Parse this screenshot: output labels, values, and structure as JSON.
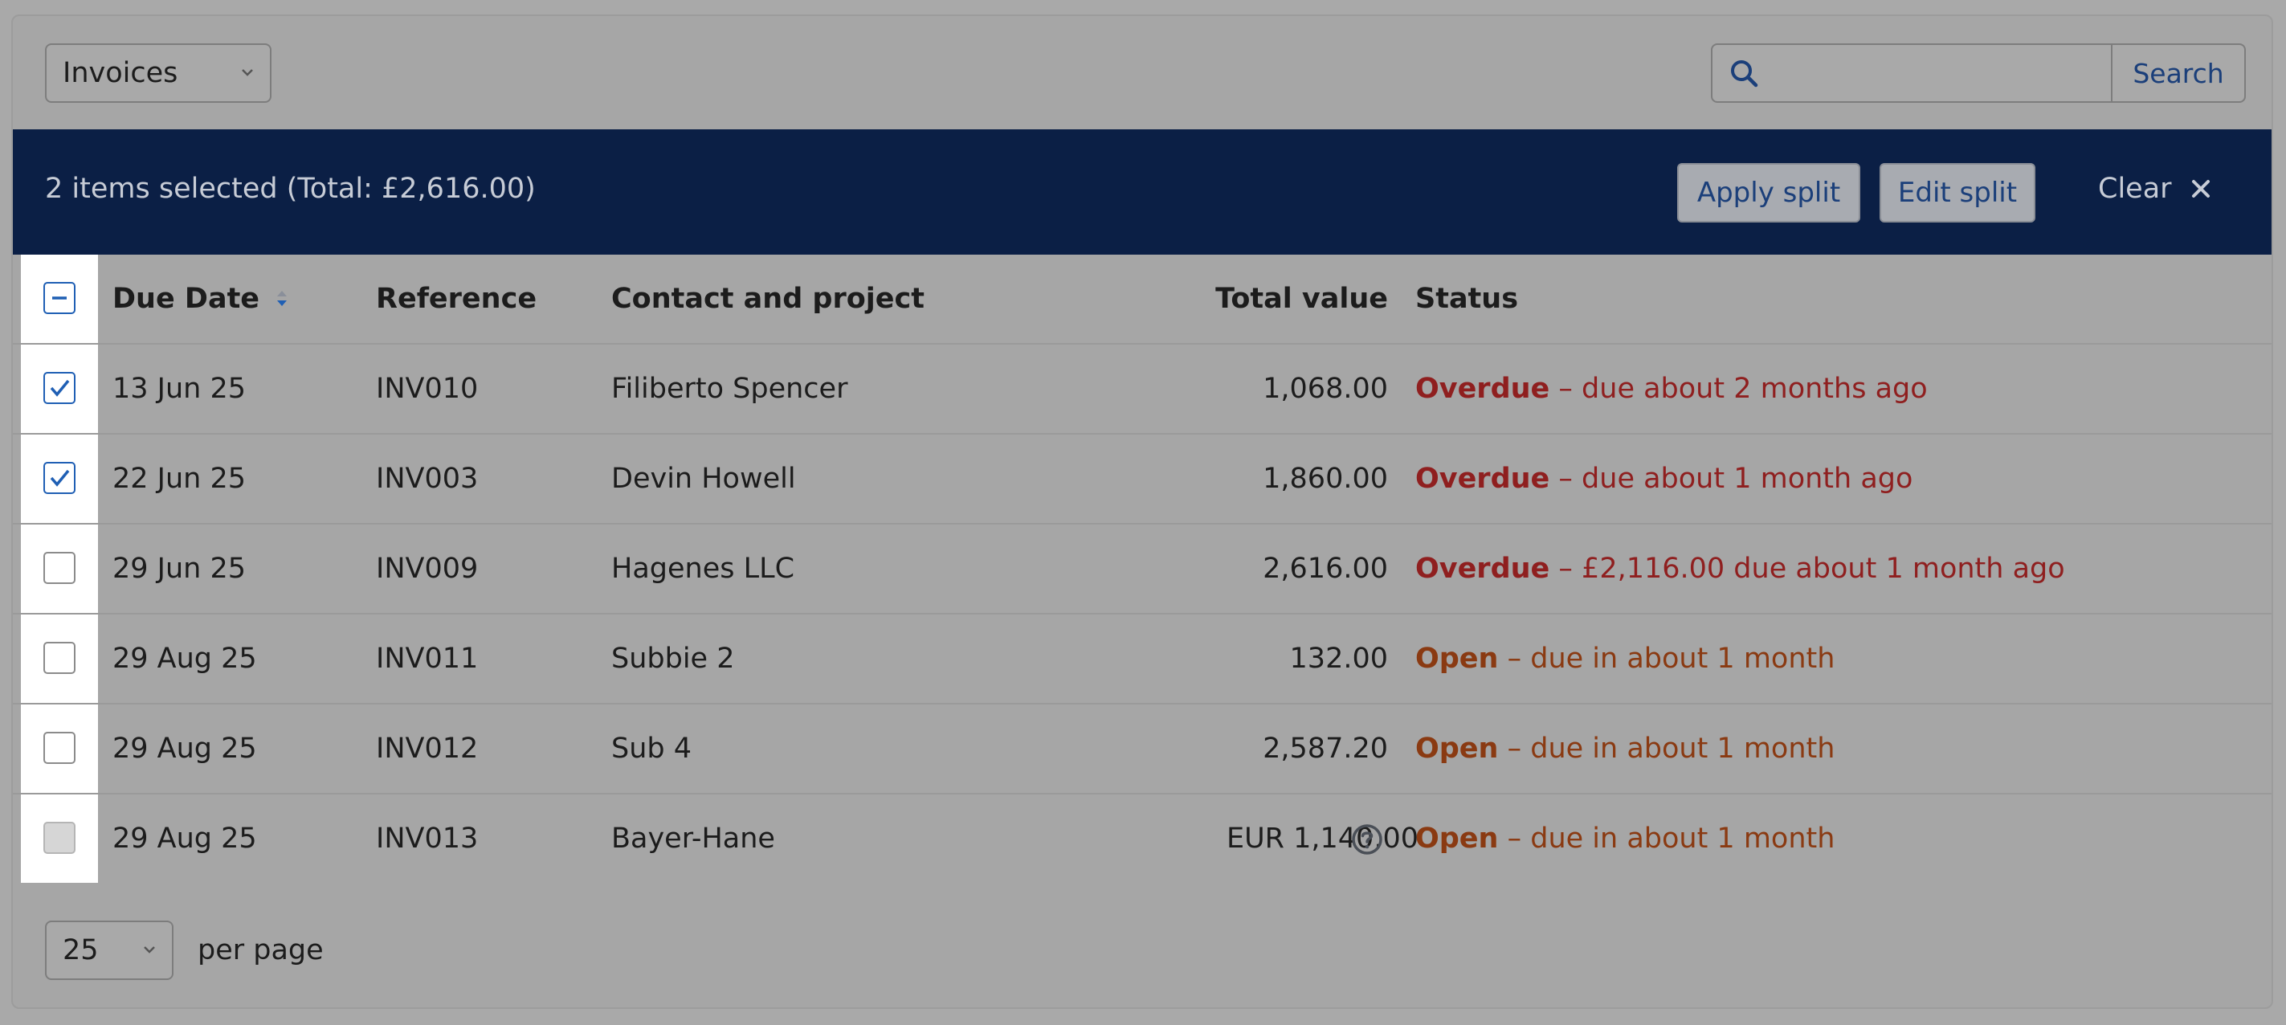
{
  "toolbar": {
    "doc_type": "Invoices",
    "search_placeholder": "",
    "search_button": "Search"
  },
  "selection_bar": {
    "text": "2 items selected (Total: £2,616.00)",
    "apply_split": "Apply split",
    "edit_split": "Edit split",
    "clear": "Clear"
  },
  "table": {
    "headers": {
      "due_date": "Due Date",
      "reference": "Reference",
      "contact": "Contact and project",
      "total": "Total value",
      "status": "Status"
    },
    "rows": [
      {
        "checked": true,
        "date": "13 Jun 25",
        "ref": "INV010",
        "contact": "Filiberto Spencer",
        "total": "1,068.00",
        "status": "Overdue",
        "detail": "– due about 2 months ago"
      },
      {
        "checked": true,
        "date": "22 Jun 25",
        "ref": "INV003",
        "contact": "Devin Howell",
        "total": "1,860.00",
        "status": "Overdue",
        "detail": "– due about 1 month ago"
      },
      {
        "checked": false,
        "date": "29 Jun 25",
        "ref": "INV009",
        "contact": "Hagenes LLC",
        "total": "2,616.00",
        "status": "Overdue",
        "detail": "– £2,116.00 due about 1 month ago"
      },
      {
        "checked": false,
        "date": "29 Aug 25",
        "ref": "INV011",
        "contact": "Subbie 2",
        "total": "132.00",
        "status": "Open",
        "detail": "– due in about 1 month"
      },
      {
        "checked": false,
        "date": "29 Aug 25",
        "ref": "INV012",
        "contact": "Sub 4",
        "total": "2,587.20",
        "status": "Open",
        "detail": "– due in about 1 month"
      },
      {
        "checked": false,
        "disabled": true,
        "date": "29 Aug 25",
        "ref": "INV013",
        "contact": "Bayer-Hane",
        "total": "EUR 1,140.00",
        "status": "Open",
        "detail": "– due in about 1 month"
      }
    ]
  },
  "pager": {
    "per_page_value": "25",
    "per_page_label": "per page"
  },
  "colors": {
    "selection_bar": "#0b1f45",
    "accent": "#1b3f7a",
    "overdue": "#8f1f1f",
    "open": "#8a3a12"
  }
}
